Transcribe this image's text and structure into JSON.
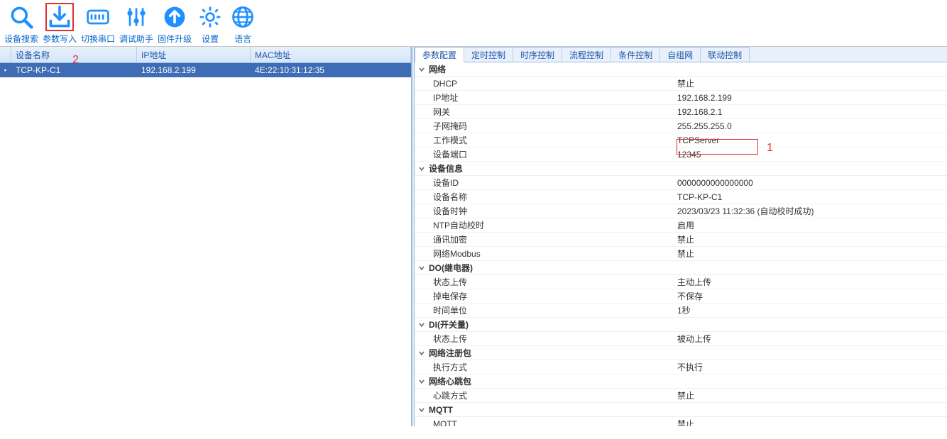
{
  "toolbar": [
    {
      "id": "search",
      "label": "设备搜索"
    },
    {
      "id": "write",
      "label": "参数写入"
    },
    {
      "id": "serial",
      "label": "切换串口"
    },
    {
      "id": "debug",
      "label": "调试助手"
    },
    {
      "id": "upgrade",
      "label": "固件升级"
    },
    {
      "id": "settings",
      "label": "设置"
    },
    {
      "id": "lang",
      "label": "语言"
    }
  ],
  "annotations": {
    "one": "1",
    "two": "2"
  },
  "deviceTable": {
    "headers": [
      "设备名称",
      "IP地址",
      "MAC地址"
    ],
    "row": {
      "name": "TCP-KP-C1",
      "ip": "192.168.2.199",
      "mac": "4E:22:10:31:12:35"
    }
  },
  "tabs": [
    "参数配置",
    "定时控制",
    "时序控制",
    "流程控制",
    "条件控制",
    "自组网",
    "联动控制"
  ],
  "props": {
    "groups": [
      {
        "title": "网络",
        "rows": [
          {
            "k": "DHCP",
            "v": "禁止"
          },
          {
            "k": "IP地址",
            "v": "192.168.2.199"
          },
          {
            "k": "网关",
            "v": "192.168.2.1"
          },
          {
            "k": "子网掩码",
            "v": "255.255.255.0"
          },
          {
            "k": "工作模式",
            "v": "TCPServer"
          },
          {
            "k": "设备端口",
            "v": "12345"
          }
        ]
      },
      {
        "title": "设备信息",
        "rows": [
          {
            "k": "设备ID",
            "v": "0000000000000000"
          },
          {
            "k": "设备名称",
            "v": "TCP-KP-C1"
          },
          {
            "k": "设备时钟",
            "v": "2023/03/23 11:32:36 (自动校时成功)"
          },
          {
            "k": "NTP自动校时",
            "v": "启用"
          },
          {
            "k": "通讯加密",
            "v": "禁止"
          },
          {
            "k": "网络Modbus",
            "v": "禁止"
          }
        ]
      },
      {
        "title": "DO(继电器)",
        "rows": [
          {
            "k": "状态上传",
            "v": "主动上传"
          },
          {
            "k": "掉电保存",
            "v": "不保存"
          },
          {
            "k": "时间单位",
            "v": "1秒"
          }
        ]
      },
      {
        "title": "DI(开关量)",
        "rows": [
          {
            "k": "状态上传",
            "v": "被动上传"
          }
        ]
      },
      {
        "title": "网络注册包",
        "rows": [
          {
            "k": "执行方式",
            "v": "不执行"
          }
        ]
      },
      {
        "title": "网络心跳包",
        "rows": [
          {
            "k": "心跳方式",
            "v": "禁止"
          }
        ]
      },
      {
        "title": "MQTT",
        "rows": [
          {
            "k": "MQTT",
            "v": "禁止"
          }
        ]
      }
    ]
  }
}
